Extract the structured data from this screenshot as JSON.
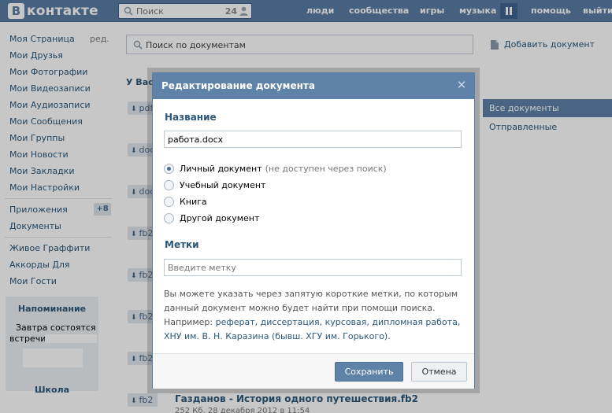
{
  "header": {
    "logo_letter": "В",
    "logo_text": "контакте",
    "search_placeholder": "Поиск",
    "search_count": "24",
    "nav": [
      "люди",
      "сообщества",
      "игры",
      "музыка",
      "помощь",
      "выйти"
    ]
  },
  "sidebar": {
    "items": [
      "Моя Страница",
      "Мои Друзья",
      "Мои Фотографии",
      "Мои Видеозаписи",
      "Мои Аудиозаписи",
      "Мои Сообщения",
      "Мои Группы",
      "Мои Новости",
      "Мои Закладки",
      "Мои Настройки"
    ],
    "edit_label": "ред.",
    "apps": "Приложения",
    "apps_badge": "+8",
    "documents": "Документы",
    "extra": [
      "Живое Граффити",
      "Аккорды Для",
      "Мои Гости"
    ],
    "reminder": {
      "title": "Напоминание",
      "line1": "Завтра состоятся",
      "line2": "встречи"
    },
    "school_title": "Школа"
  },
  "main": {
    "search_placeholder": "Поиск по документам",
    "add_document": "Добавить документ",
    "section_heading": "У Вас",
    "doc_tags": [
      "pdf",
      "doc",
      "doc",
      "fb2",
      "fb2",
      "fb2",
      "fb2",
      "fb2"
    ],
    "right_menu": {
      "active": "Все документы",
      "item": "Отправленные"
    },
    "last_doc": {
      "title": "Газданов - История одного путешествия.fb2",
      "meta": "252 Кб, 28 декабря 2012 в 11:54"
    }
  },
  "modal": {
    "title": "Редактирование документа",
    "name_label": "Название",
    "name_value": "работа.docx",
    "radios": [
      {
        "label": "Личный документ",
        "hint": "(не доступен через поиск)",
        "checked": true
      },
      {
        "label": "Учебный документ",
        "hint": "",
        "checked": false
      },
      {
        "label": "Книга",
        "hint": "",
        "checked": false
      },
      {
        "label": "Другой документ",
        "hint": "",
        "checked": false
      }
    ],
    "tags_label": "Метки",
    "tags_placeholder": "Введите метку",
    "help": {
      "text1": "Вы можете указать через запятую короткие метки, по которым данный документ можно будет найти при помощи поиска. Например: ",
      "link": "реферат, диссертация, курсовая, дипломная работа, ХНУ им. В. Н. Каразина (бывш. ХГУ им. Горького).",
      "text2": ""
    },
    "save_label": "Сохранить",
    "cancel_label": "Отмена"
  },
  "colors": {
    "header_blue": "#597da3",
    "accent_blue": "#5e82a8",
    "link_blue": "#2b587a"
  }
}
